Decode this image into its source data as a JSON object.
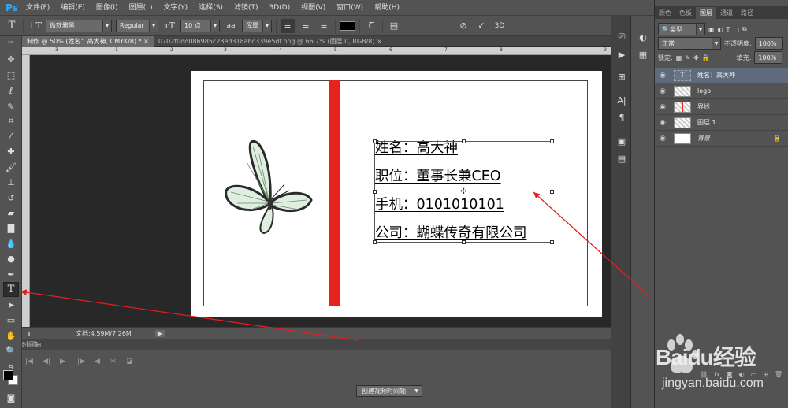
{
  "menubar": {
    "logo": "Ps",
    "items": [
      "文件(F)",
      "编辑(E)",
      "图像(I)",
      "图层(L)",
      "文字(Y)",
      "选择(S)",
      "滤镜(T)",
      "3D(D)",
      "视图(V)",
      "窗口(W)",
      "帮助(H)"
    ],
    "win_min": "—",
    "win_max": "□",
    "win_close": "✕"
  },
  "options": {
    "font_family": "微软雅黑",
    "font_style": "Regular",
    "font_size": "10 点",
    "antialias_label": "aa",
    "antialias": "浑厚",
    "threed_label": "3D"
  },
  "tabs": [
    {
      "label": "制作 @ 50% (姓名：高大神, CMYK/8) *",
      "close": "×",
      "active": true
    },
    {
      "label": "0702f0dd086985c28ed318abc339e5df.png @ 66.7% (图层 0, RGB/8)",
      "close": "×",
      "active": false
    }
  ],
  "ruler_ticks": [
    "3",
    "1",
    "2",
    "3",
    "4",
    "5",
    "6",
    "7",
    "8",
    "9"
  ],
  "card": {
    "lines": [
      "姓名：高大神",
      "职位：董事长兼CEO",
      "手机：0101010101",
      "公司：蝴蝶传奇有限公司"
    ]
  },
  "status": {
    "doc_info": "文档:4.59M/7.26M"
  },
  "timeline": {
    "title": "时间轴",
    "create_button": "创建视频时间轴"
  },
  "layers_panel": {
    "tabs": [
      "颜色",
      "色板",
      "图层",
      "通道",
      "路径"
    ],
    "active_tab": "图层",
    "filter_label": "类型",
    "blend_mode": "正常",
    "opacity_label": "不透明度:",
    "opacity": "100%",
    "lock_label": "锁定:",
    "fill_label": "填充:",
    "fill": "100%",
    "layers": [
      {
        "name": "姓名：高大神",
        "type": "text",
        "selected": true
      },
      {
        "name": "logo",
        "type": "image",
        "selected": false
      },
      {
        "name": "界线",
        "type": "image",
        "selected": false
      },
      {
        "name": "图层 1",
        "type": "image",
        "selected": false
      },
      {
        "name": "背景",
        "type": "background",
        "selected": false
      }
    ]
  },
  "watermark": {
    "brand": "Baidu经验",
    "url": "jingyan.baidu.com"
  },
  "colors": {
    "accent": "#31a8ff",
    "red_bar": "#e5231f",
    "arrow": "#e02020",
    "selected_layer": "#5f6b7c"
  }
}
